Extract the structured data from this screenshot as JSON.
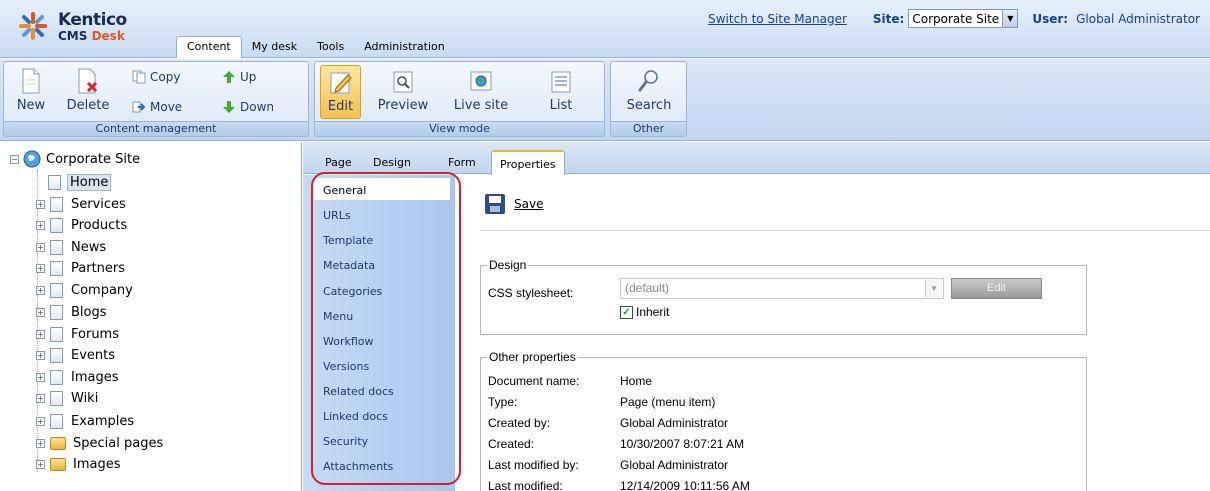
{
  "header": {
    "logo_name": "Kentico",
    "logo_product": "CMS",
    "logo_product_suffix": "Desk",
    "tabs": [
      {
        "label": "Content",
        "active": true
      },
      {
        "label": "My desk"
      },
      {
        "label": "Tools"
      },
      {
        "label": "Administration"
      }
    ],
    "switch_link": "Switch to Site Manager",
    "site_label": "Site:",
    "site_value": "Corporate Site",
    "user_label": "User:",
    "user_value": "Global Administrator"
  },
  "toolbar": {
    "content_management": {
      "group_label": "Content management",
      "new": "New",
      "delete": "Delete",
      "copy": "Copy",
      "move": "Move",
      "up": "Up",
      "down": "Down"
    },
    "view_mode": {
      "group_label": "View mode",
      "edit": "Edit",
      "preview": "Preview",
      "live_site": "Live site",
      "list": "List"
    },
    "other": {
      "group_label": "Other",
      "search": "Search"
    }
  },
  "tree": {
    "root": "Corporate Site",
    "items": [
      {
        "label": "Home",
        "selected": true,
        "icon": "document-icon"
      },
      {
        "label": "Services",
        "icon": "document-icon"
      },
      {
        "label": "Products",
        "icon": "document-icon"
      },
      {
        "label": "News",
        "icon": "document-icon"
      },
      {
        "label": "Partners",
        "icon": "document-icon"
      },
      {
        "label": "Company",
        "icon": "document-icon"
      },
      {
        "label": "Blogs",
        "icon": "document-icon"
      },
      {
        "label": "Forums",
        "icon": "document-icon"
      },
      {
        "label": "Events",
        "icon": "document-icon"
      },
      {
        "label": "Images",
        "icon": "document-icon"
      },
      {
        "label": "Wiki",
        "icon": "document-icon"
      },
      {
        "label": "Examples",
        "icon": "document-icon"
      },
      {
        "label": "Special pages",
        "icon": "folder-icon"
      },
      {
        "label": "Images",
        "icon": "folder-icon"
      }
    ]
  },
  "content_tabs": [
    {
      "label": "Page"
    },
    {
      "label": "Design"
    },
    {
      "label": "Form"
    },
    {
      "label": "Properties",
      "active": true
    }
  ],
  "properties_nav": [
    {
      "label": "General",
      "active": true
    },
    {
      "label": "URLs"
    },
    {
      "label": "Template"
    },
    {
      "label": "Metadata"
    },
    {
      "label": "Categories"
    },
    {
      "label": "Menu"
    },
    {
      "label": "Workflow"
    },
    {
      "label": "Versions"
    },
    {
      "label": "Related docs"
    },
    {
      "label": "Linked docs"
    },
    {
      "label": "Security"
    },
    {
      "label": "Attachments"
    }
  ],
  "general": {
    "save_label": "Save",
    "design_legend": "Design",
    "css_label": "CSS stylesheet:",
    "css_value": "(default)",
    "edit_button": "Edit",
    "inherit_label": "Inherit",
    "inherit_checked": true,
    "other_legend": "Other properties",
    "properties": [
      {
        "label": "Document name:",
        "value": "Home"
      },
      {
        "label": "Type:",
        "value": "Page (menu item)"
      },
      {
        "label": "Created by:",
        "value": "Global Administrator"
      },
      {
        "label": "Created:",
        "value": "10/30/2007 8:07:21 AM"
      },
      {
        "label": "Last modified by:",
        "value": "Global Administrator"
      },
      {
        "label": "Last modified:",
        "value": "12/14/2009 10:11:56 AM"
      }
    ]
  },
  "colors": {
    "highlight_outline": "#d8202a",
    "active_tab_accent": "#f0b428",
    "link": "#1a3f93"
  }
}
